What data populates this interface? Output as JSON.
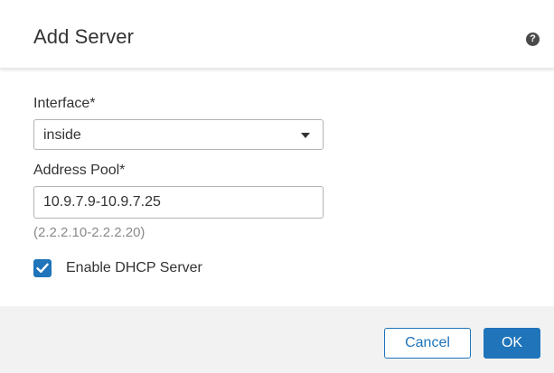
{
  "dialog": {
    "title": "Add Server",
    "help_icon": "question-circle-icon",
    "help_glyph": "?"
  },
  "form": {
    "interface": {
      "label": "Interface*",
      "selected_value": "inside",
      "icon": "chevron-down-icon"
    },
    "address_pool": {
      "label": "Address Pool*",
      "value": "10.9.7.9-10.9.7.25",
      "hint": "(2.2.2.10-2.2.2.20)"
    },
    "enable_dhcp": {
      "label": "Enable DHCP Server",
      "checked": true,
      "icon": "checkmark-icon"
    }
  },
  "footer": {
    "cancel_label": "Cancel",
    "ok_label": "OK"
  },
  "colors": {
    "accent": "#1f74ba",
    "footer_bg": "#f2f2f2",
    "hint_text": "#8a8a8a"
  }
}
